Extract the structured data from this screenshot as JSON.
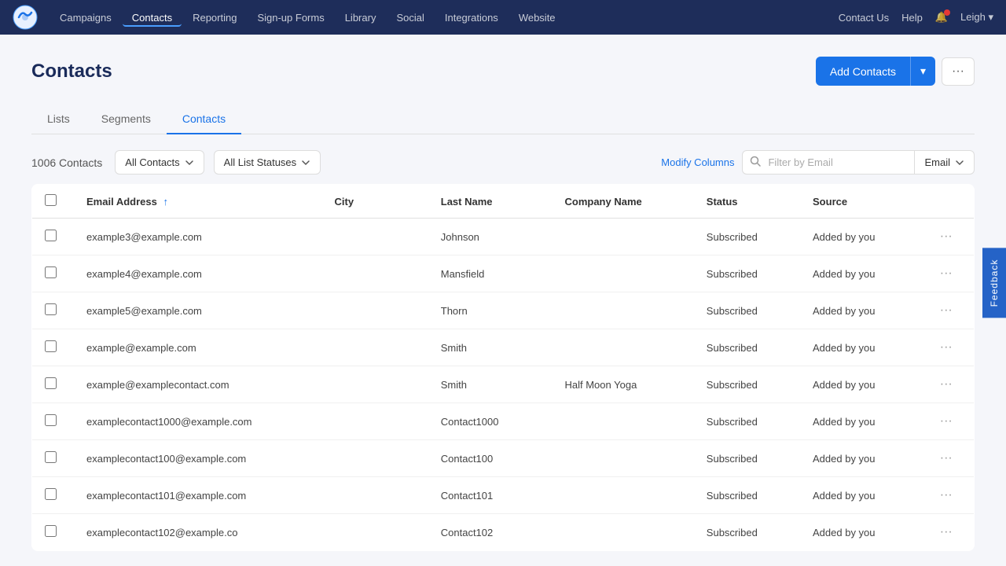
{
  "nav": {
    "links": [
      {
        "label": "Campaigns",
        "active": false
      },
      {
        "label": "Contacts",
        "active": true
      },
      {
        "label": "Reporting",
        "active": false
      },
      {
        "label": "Sign-up Forms",
        "active": false
      },
      {
        "label": "Library",
        "active": false
      },
      {
        "label": "Social",
        "active": false
      },
      {
        "label": "Integrations",
        "active": false
      },
      {
        "label": "Website",
        "active": false
      }
    ],
    "right": {
      "contact_us": "Contact Us",
      "help": "Help",
      "user": "Leigh"
    }
  },
  "page": {
    "title": "Contacts",
    "add_contacts_label": "Add Contacts",
    "more_icon": "···"
  },
  "tabs": [
    {
      "label": "Lists",
      "active": false
    },
    {
      "label": "Segments",
      "active": false
    },
    {
      "label": "Contacts",
      "active": true
    }
  ],
  "toolbar": {
    "contacts_count": "1006 Contacts",
    "all_contacts_label": "All Contacts",
    "all_list_statuses_label": "All List Statuses",
    "modify_columns_label": "Modify Columns",
    "search_placeholder": "Filter by Email",
    "search_type_label": "Email"
  },
  "table": {
    "columns": [
      {
        "label": "Email Address",
        "sortable": true
      },
      {
        "label": "City"
      },
      {
        "label": "Last Name"
      },
      {
        "label": "Company Name"
      },
      {
        "label": "Status"
      },
      {
        "label": "Source"
      }
    ],
    "rows": [
      {
        "email": "example3@example.com",
        "city": "",
        "last_name": "Johnson",
        "company": "",
        "status": "Subscribed",
        "source": "Added by you"
      },
      {
        "email": "example4@example.com",
        "city": "",
        "last_name": "Mansfield",
        "company": "",
        "status": "Subscribed",
        "source": "Added by you"
      },
      {
        "email": "example5@example.com",
        "city": "",
        "last_name": "Thorn",
        "company": "",
        "status": "Subscribed",
        "source": "Added by you"
      },
      {
        "email": "example@example.com",
        "city": "",
        "last_name": "Smith",
        "company": "",
        "status": "Subscribed",
        "source": "Added by you"
      },
      {
        "email": "example@examplecontact.com",
        "city": "",
        "last_name": "Smith",
        "company": "Half Moon Yoga",
        "status": "Subscribed",
        "source": "Added by you"
      },
      {
        "email": "examplecontact1000@example.com",
        "city": "",
        "last_name": "Contact1000",
        "company": "",
        "status": "Subscribed",
        "source": "Added by you"
      },
      {
        "email": "examplecontact100@example.com",
        "city": "",
        "last_name": "Contact100",
        "company": "",
        "status": "Subscribed",
        "source": "Added by you"
      },
      {
        "email": "examplecontact101@example.com",
        "city": "",
        "last_name": "Contact101",
        "company": "",
        "status": "Subscribed",
        "source": "Added by you"
      },
      {
        "email": "examplecontact102@example.co",
        "city": "",
        "last_name": "Contact102",
        "company": "",
        "status": "Subscribed",
        "source": "Added by you"
      }
    ]
  },
  "feedback": {
    "label": "Feedback"
  }
}
